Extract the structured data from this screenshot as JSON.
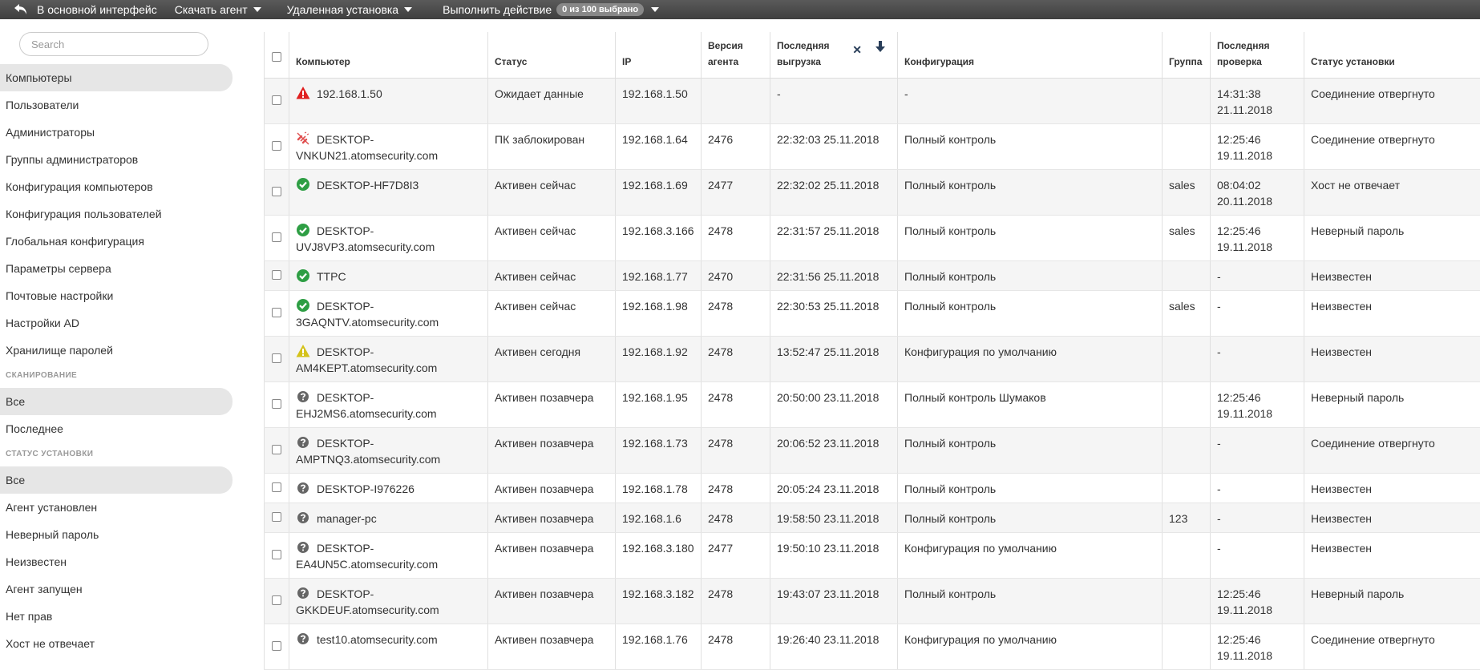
{
  "toolbar": {
    "back_label": "В основной интерфейс",
    "download_label": "Скачать агент",
    "remote_label": "Удаленная установка",
    "action_label": "Выполнить действие",
    "selected_badge": "0 из 100 выбрано"
  },
  "sidebar": {
    "search_placeholder": "Search",
    "items": [
      {
        "label": "Компьютеры",
        "active": true
      },
      {
        "label": "Пользователи"
      },
      {
        "label": "Администраторы"
      },
      {
        "label": "Группы администраторов"
      },
      {
        "label": "Конфигурация компьютеров"
      },
      {
        "label": "Конфигурация пользователей"
      },
      {
        "label": "Глобальная конфигурация"
      },
      {
        "label": "Параметры сервера"
      },
      {
        "label": "Почтовые настройки"
      },
      {
        "label": "Настройки AD"
      },
      {
        "label": "Хранилище паролей"
      }
    ],
    "scan_section": "СКАНИРОВАНИЕ",
    "scan_items": [
      {
        "label": "Все",
        "active": true
      },
      {
        "label": "Последнее"
      }
    ],
    "install_section": "СТАТУС УСТАНОВКИ",
    "install_items": [
      {
        "label": "Все",
        "active": true
      },
      {
        "label": "Агент установлен"
      },
      {
        "label": "Неверный пароль"
      },
      {
        "label": "Неизвестен"
      },
      {
        "label": "Агент запущен"
      },
      {
        "label": "Нет прав"
      },
      {
        "label": "Хост не отвечает"
      }
    ]
  },
  "table": {
    "headers": {
      "computer": "Компьютер",
      "status": "Статус",
      "ip": "IP",
      "agent_version_1": "Версия",
      "agent_version_2": "агента",
      "last_upload_1": "Последняя",
      "last_upload_2": "выгрузка",
      "config": "Конфигурация",
      "group": "Группа",
      "last_check_1": "Последняя",
      "last_check_2": "проверка",
      "install_status": "Статус установки"
    },
    "rows": [
      {
        "icon": "error-triangle-icon",
        "computer": "192.168.1.50",
        "status": "Ожидает данные",
        "ip": "192.168.1.50",
        "version": "",
        "upload": "-",
        "config": "-",
        "group": "",
        "check_time": "14:31:38",
        "check_date": "21.11.2018",
        "install": "Соединение отвергнуто"
      },
      {
        "icon": "blocked-link-icon",
        "computer": "DESKTOP-VNKUN21.atomsecurity.com",
        "status": "ПК заблокирован",
        "ip": "192.168.1.64",
        "version": "2476",
        "upload": "22:32:03 25.11.2018",
        "config": "Полный контроль",
        "group": "",
        "check_time": "12:25:46",
        "check_date": "19.11.2018",
        "install": "Соединение отвергнуто"
      },
      {
        "icon": "check-circle-icon",
        "computer": "DESKTOP-HF7D8I3",
        "status": "Активен сейчас",
        "ip": "192.168.1.69",
        "version": "2477",
        "upload": "22:32:02 25.11.2018",
        "config": "Полный контроль",
        "group": "sales",
        "check_time": "08:04:02",
        "check_date": "20.11.2018",
        "install": "Хост не отвечает"
      },
      {
        "icon": "check-circle-icon",
        "computer": "DESKTOP-UVJ8VP3.atomsecurity.com",
        "status": "Активен сейчас",
        "ip": "192.168.3.166",
        "version": "2478",
        "upload": "22:31:57 25.11.2018",
        "config": "Полный контроль",
        "group": "sales",
        "check_time": "12:25:46",
        "check_date": "19.11.2018",
        "install": "Неверный пароль"
      },
      {
        "icon": "check-circle-icon",
        "computer": "TTPC",
        "status": "Активен сейчас",
        "ip": "192.168.1.77",
        "version": "2470",
        "upload": "22:31:56 25.11.2018",
        "config": "Полный контроль",
        "group": "",
        "check_time": "-",
        "check_date": "",
        "install": "Неизвестен"
      },
      {
        "icon": "check-circle-icon",
        "computer": "DESKTOP-3GAQNTV.atomsecurity.com",
        "status": "Активен сейчас",
        "ip": "192.168.1.98",
        "version": "2478",
        "upload": "22:30:53 25.11.2018",
        "config": "Полный контроль",
        "group": "sales",
        "check_time": "-",
        "check_date": "",
        "install": "Неизвестен"
      },
      {
        "icon": "warning-triangle-icon",
        "computer": "DESKTOP-AM4KEPT.atomsecurity.com",
        "status": "Активен сегодня",
        "ip": "192.168.1.92",
        "version": "2478",
        "upload": "13:52:47 25.11.2018",
        "config": "Конфигурация по умолчанию",
        "group": "",
        "check_time": "-",
        "check_date": "",
        "install": "Неизвестен"
      },
      {
        "icon": "question-circle-icon",
        "computer": "DESKTOP-EHJ2MS6.atomsecurity.com",
        "status": "Активен позавчера",
        "ip": "192.168.1.95",
        "version": "2478",
        "upload": "20:50:00 23.11.2018",
        "config": "Полный контроль Шумаков",
        "group": "",
        "check_time": "12:25:46",
        "check_date": "19.11.2018",
        "install": "Неверный пароль"
      },
      {
        "icon": "question-circle-icon",
        "computer": "DESKTOP-AMPTNQ3.atomsecurity.com",
        "status": "Активен позавчера",
        "ip": "192.168.1.73",
        "version": "2478",
        "upload": "20:06:52 23.11.2018",
        "config": "Полный контроль",
        "group": "",
        "check_time": "-",
        "check_date": "",
        "install": "Соединение отвергнуто"
      },
      {
        "icon": "question-circle-icon",
        "computer": "DESKTOP-I976226",
        "status": "Активен позавчера",
        "ip": "192.168.1.78",
        "version": "2478",
        "upload": "20:05:24 23.11.2018",
        "config": "Полный контроль",
        "group": "",
        "check_time": "-",
        "check_date": "",
        "install": "Неизвестен"
      },
      {
        "icon": "question-circle-icon",
        "computer": "manager-pc",
        "status": "Активен позавчера",
        "ip": "192.168.1.6",
        "version": "2478",
        "upload": "19:58:50 23.11.2018",
        "config": "Полный контроль",
        "group": "123",
        "check_time": "-",
        "check_date": "",
        "install": "Неизвестен"
      },
      {
        "icon": "question-circle-icon",
        "computer": "DESKTOP-EA4UN5C.atomsecurity.com",
        "status": "Активен позавчера",
        "ip": "192.168.3.180",
        "version": "2477",
        "upload": "19:50:10 23.11.2018",
        "config": "Конфигурация по умолчанию",
        "group": "",
        "check_time": "-",
        "check_date": "",
        "install": "Неизвестен"
      },
      {
        "icon": "question-circle-icon",
        "computer": "DESKTOP-GKKDEUF.atomsecurity.com",
        "status": "Активен позавчера",
        "ip": "192.168.3.182",
        "version": "2478",
        "upload": "19:43:07 23.11.2018",
        "config": "Полный контроль",
        "group": "",
        "check_time": "12:25:46",
        "check_date": "19.11.2018",
        "install": "Неверный пароль"
      },
      {
        "icon": "question-circle-icon",
        "computer": "test10.atomsecurity.com",
        "status": "Активен позавчера",
        "ip": "192.168.1.76",
        "version": "2478",
        "upload": "19:26:40 23.11.2018",
        "config": "Конфигурация по умолчанию",
        "group": "",
        "check_time": "12:25:46",
        "check_date": "19.11.2018",
        "install": "Соединение отвергнуто"
      }
    ]
  },
  "colors": {
    "ok": "#2e9e44",
    "error": "#e02020",
    "warning": "#d4c21a",
    "unknown": "#666666",
    "blocked": "#e05050"
  }
}
